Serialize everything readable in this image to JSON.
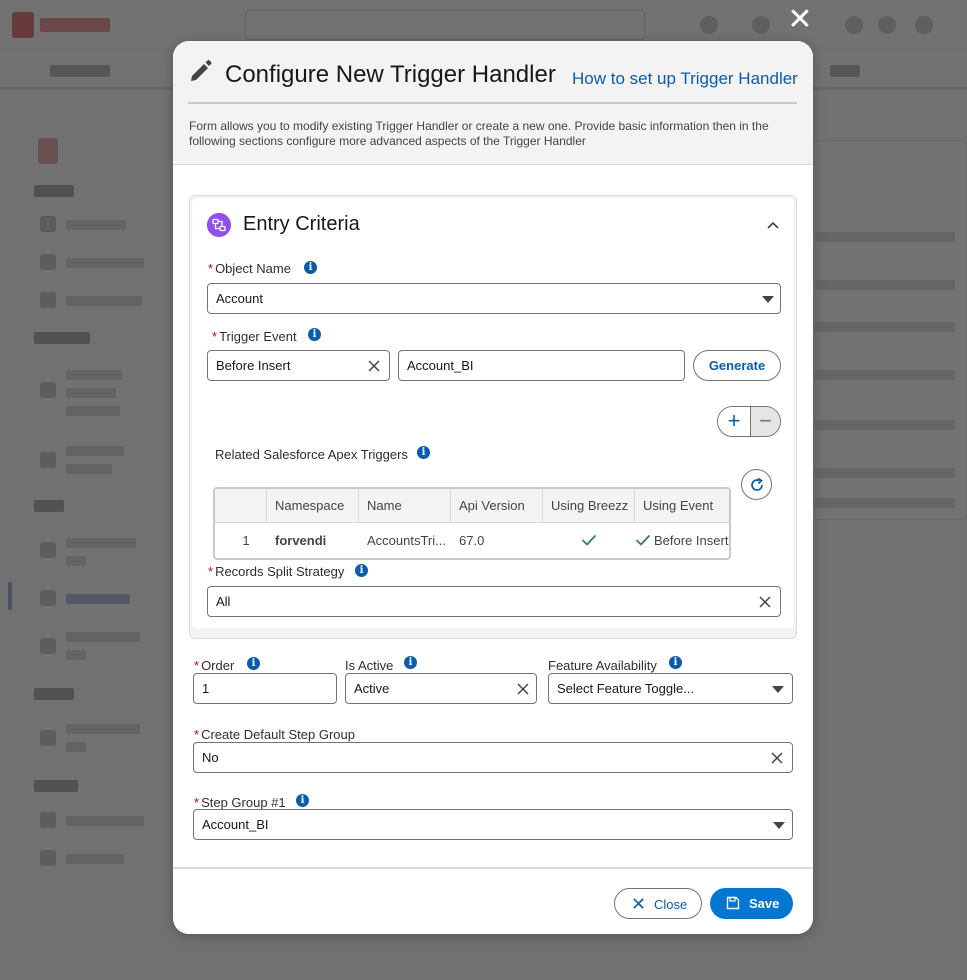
{
  "modal": {
    "title": "Configure New Trigger Handler",
    "help_link": "How to set up Trigger Handler",
    "description": "Form allows you to modify existing Trigger Handler or create a new one. Provide basic information then in the following sections configure more advanced aspects of the Trigger Handler",
    "close_icon_glyph": "✕"
  },
  "entry_criteria": {
    "title": "Entry Criteria",
    "object_name": {
      "label": "Object Name",
      "value": "Account"
    },
    "trigger_event": {
      "label": "Trigger Event",
      "value": "Before Insert",
      "name_value": "Account_BI",
      "generate_label": "Generate"
    },
    "add_button": "+",
    "remove_button": "−",
    "related_triggers": {
      "label": "Related Salesforce Apex Triggers",
      "columns": [
        "Namespace",
        "Name",
        "Api Version",
        "Using Breezz",
        "Using Event"
      ],
      "rows": [
        {
          "index": "1",
          "namespace": "forvendi",
          "name": "AccountsTri...",
          "api_version": "67.0",
          "using_event": "Before Insert"
        }
      ]
    },
    "split_strategy": {
      "label": "Records Split Strategy",
      "value": "All"
    }
  },
  "settings": {
    "order": {
      "label": "Order",
      "value": "1"
    },
    "is_active": {
      "label": "Is Active",
      "value": "Active"
    },
    "feature": {
      "label": "Feature Availability",
      "placeholder": "Select Feature Toggle..."
    },
    "default_step_group": {
      "label": "Create Default Step Group",
      "value": "No"
    },
    "step_group": {
      "label": "Step Group #1",
      "value": "Account_BI"
    }
  },
  "footer": {
    "close_label": "Close",
    "save_label": "Save"
  },
  "icons": {
    "edit": "pencil-icon",
    "section": "flow-icon",
    "info": "info-icon",
    "refresh": "refresh-icon"
  },
  "colors": {
    "brand": "#0176d3",
    "link": "#0b5cab",
    "section_icon": "#9050e9",
    "required": "#ba0517",
    "check": "#2e844a"
  }
}
